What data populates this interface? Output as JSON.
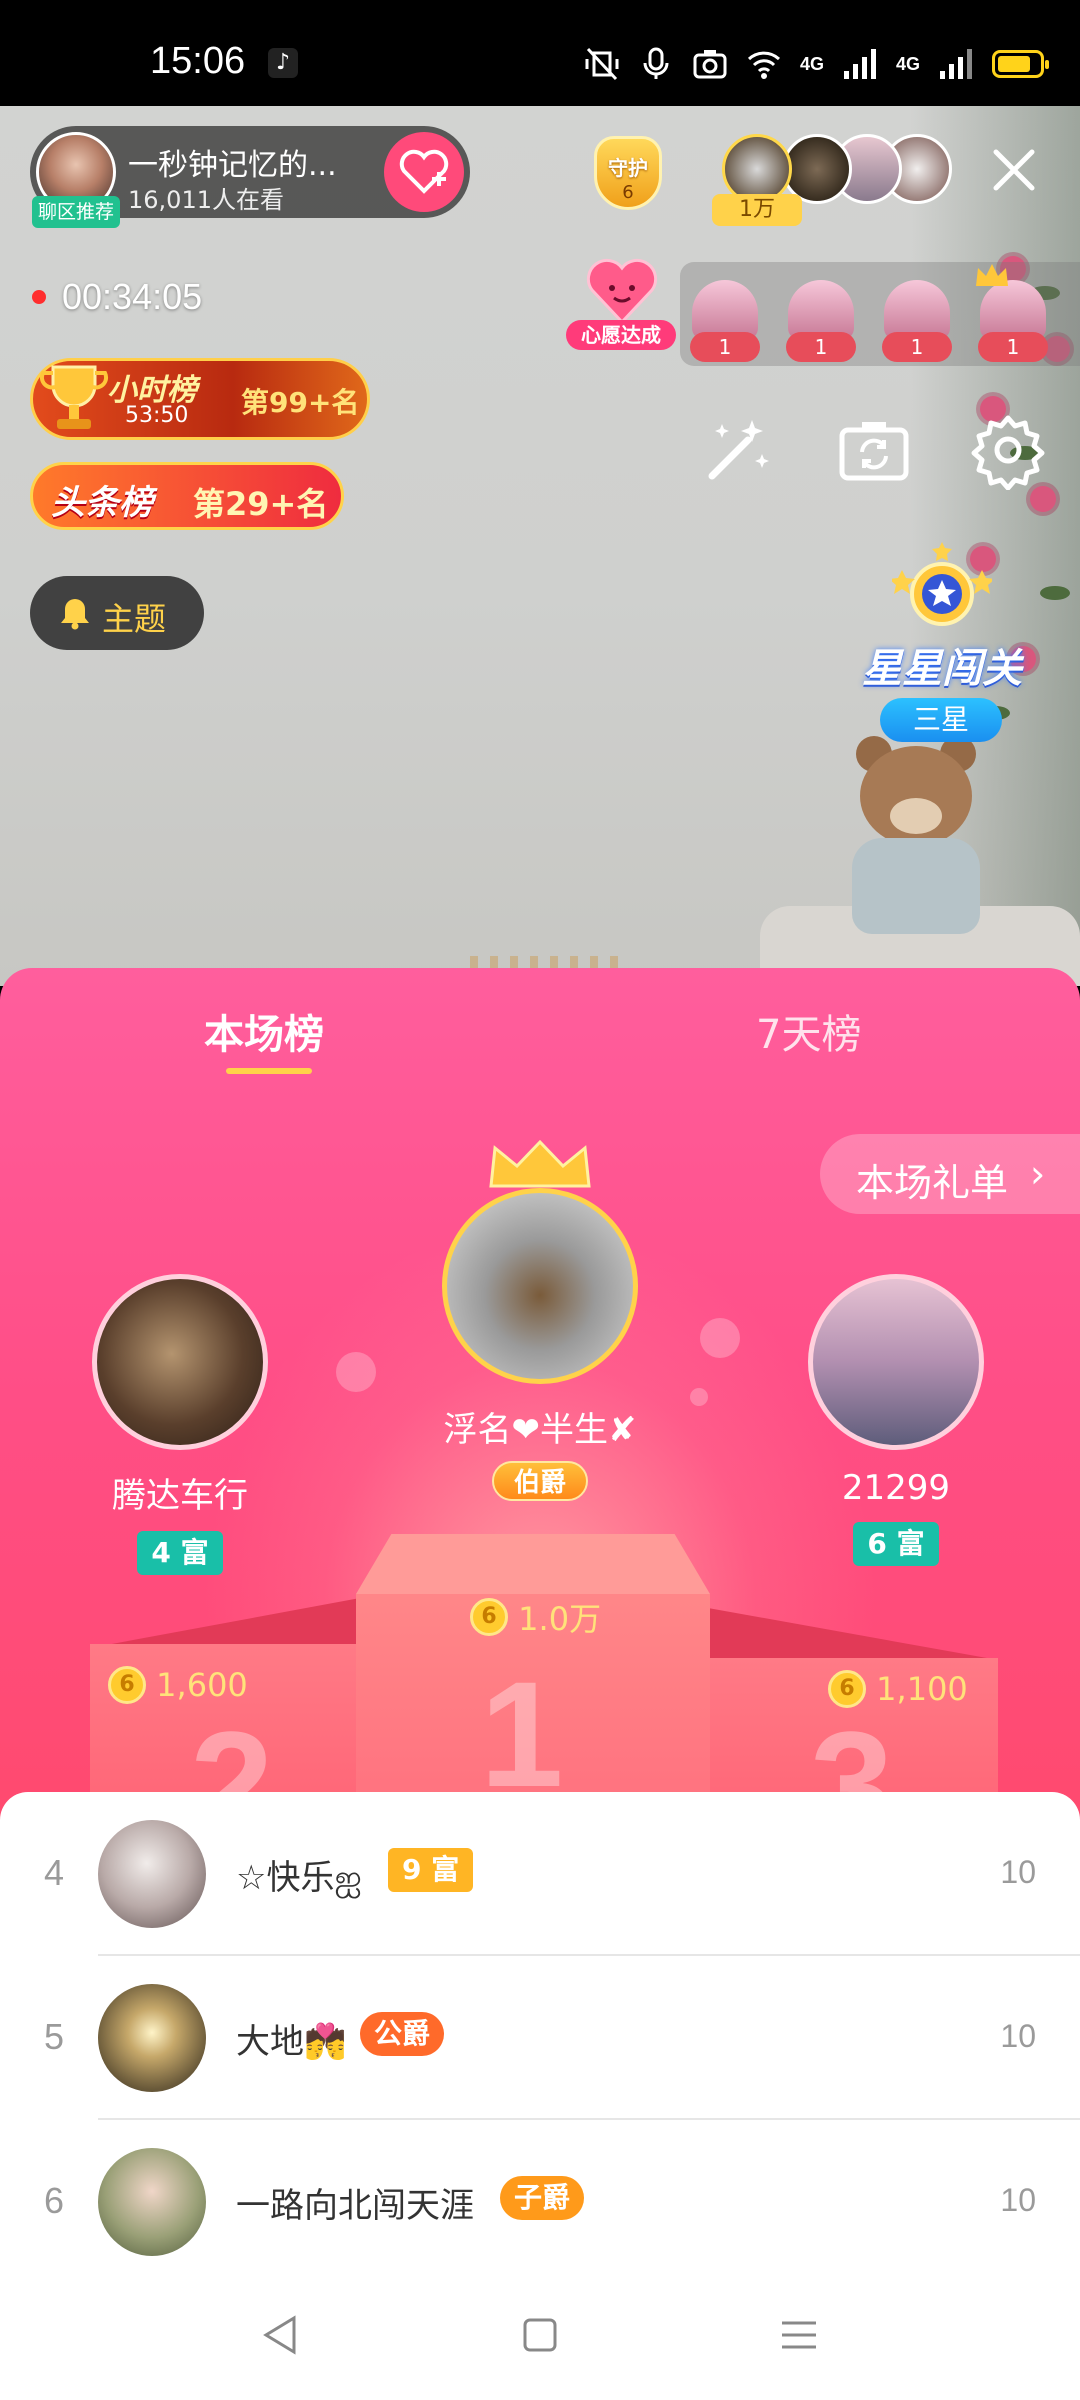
{
  "status_bar": {
    "time": "15:06",
    "network_1": "4G",
    "network_2": "4G",
    "battery_level": 0.8,
    "icons": [
      "tiktok-icon",
      "mute-vibrate-icon",
      "mic-icon",
      "camera-icon",
      "wifi-icon",
      "signal-icon",
      "signal-icon",
      "battery-icon"
    ]
  },
  "anchor": {
    "name": "一秒钟记忆的...",
    "viewers": "16,011人在看",
    "tag": "聊区推荐"
  },
  "guard": {
    "label": "守护",
    "count": "6"
  },
  "viewer_badge": "1万",
  "live_timer": "00:34:05",
  "hour_rank": {
    "title": "小时榜",
    "countdown": "53:50",
    "rank": "第99+名"
  },
  "headline_rank": {
    "title": "头条榜",
    "rank": "第29+名"
  },
  "topic_button": "主题",
  "wish": {
    "label": "心愿达成"
  },
  "gift_slots": [
    {
      "count": "1"
    },
    {
      "count": "1"
    },
    {
      "count": "1"
    },
    {
      "count": "1"
    }
  ],
  "star_challenge": {
    "title": "星星闯关",
    "level": "三星"
  },
  "panel": {
    "tabs": [
      {
        "label": "本场榜",
        "active": true
      },
      {
        "label": "7天榜",
        "active": false
      }
    ],
    "gift_list_button": "本场礼单",
    "podium": {
      "first": {
        "name": "浮名❤半生✘",
        "badge": "伯爵",
        "value": "1.0万",
        "place": "1"
      },
      "second": {
        "name": "腾达车行",
        "badge": "4 富",
        "value": "1,600",
        "place": "2"
      },
      "third": {
        "name": "21299",
        "badge": "6 富",
        "value": "1,100",
        "place": "3"
      }
    },
    "list": [
      {
        "rank": "4",
        "name": "☆快乐ஐ",
        "badge": "9 富",
        "badge_color": "#ffb524",
        "value": "10"
      },
      {
        "rank": "5",
        "name": "大地💏",
        "badge": "公爵",
        "badge_color": "#ff6a2a",
        "value": "10"
      },
      {
        "rank": "6",
        "name": "一路向北闯天涯",
        "badge": "子爵",
        "badge_color": "#ff9a1a",
        "value": "10"
      }
    ]
  },
  "coin_glyph": "6",
  "colors": {
    "panel_top": "#ff5e9d",
    "panel_bottom": "#ff5266",
    "accent_gold": "#ffd24a",
    "wealth_badge": "#19bfa8"
  }
}
